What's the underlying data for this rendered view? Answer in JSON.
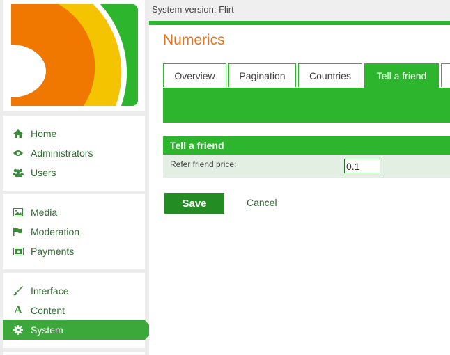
{
  "topbar": {
    "version_text": "System version: Flirt"
  },
  "page": {
    "title": "Numerics"
  },
  "tabs": [
    {
      "label": "Overview"
    },
    {
      "label": "Pagination"
    },
    {
      "label": "Countries"
    },
    {
      "label": "Tell a friend",
      "active": true
    },
    {
      "label": ""
    }
  ],
  "sidebar": {
    "group1": [
      {
        "label": "Home",
        "icon": "home-icon"
      },
      {
        "label": "Administrators",
        "icon": "eye-icon"
      },
      {
        "label": "Users",
        "icon": "users-icon"
      }
    ],
    "group2": [
      {
        "label": "Media",
        "icon": "image-icon"
      },
      {
        "label": "Moderation",
        "icon": "flag-icon"
      },
      {
        "label": "Payments",
        "icon": "money-icon"
      }
    ],
    "group3": [
      {
        "label": "Interface",
        "icon": "brush-icon"
      },
      {
        "label": "Content",
        "icon": "font-icon"
      },
      {
        "label": "System",
        "icon": "gear-icon",
        "active": true
      }
    ]
  },
  "section": {
    "title": "Tell a friend",
    "field_label": "Refer friend price:",
    "field_value": "0.1"
  },
  "actions": {
    "save_label": "Save",
    "cancel_label": "Cancel"
  },
  "colors": {
    "accent": "#2db52d",
    "title": "#e8731c",
    "active_menu": "#3ca83c",
    "link": "#2e6b2e"
  }
}
